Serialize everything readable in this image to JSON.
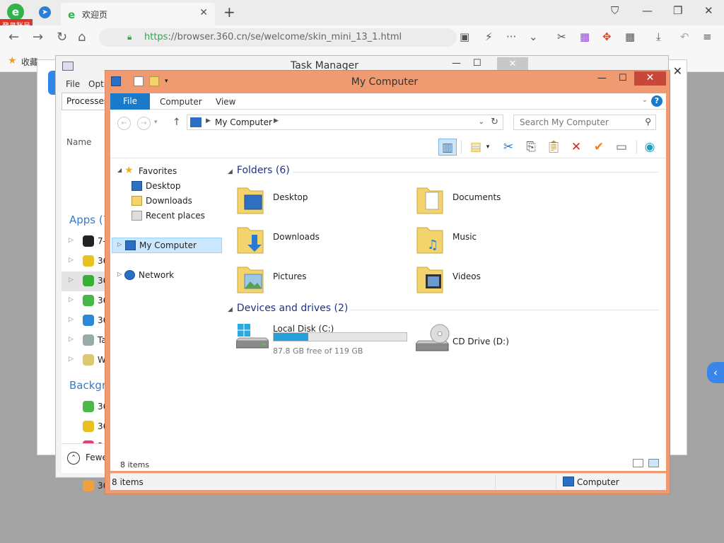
{
  "browser": {
    "logo_letter": "e",
    "login_badge": "登录账号",
    "tab_title": "欢迎页",
    "tab_favicon": "e",
    "url_proto": "https",
    "url_rest": "://browser.360.cn/se/welcome/skin_mini_13_1.html",
    "bookmark_label": "收藏"
  },
  "task_manager": {
    "title": "Task Manager",
    "menu": [
      "File",
      "Opti"
    ],
    "tab": "Processes",
    "col_name": "Name",
    "apps_group": "Apps (7",
    "background_group": "Backgro",
    "apps": [
      "7-",
      "36",
      "36",
      "36",
      "36",
      "Ta",
      "W"
    ],
    "background": [
      "36",
      "36",
      "36",
      "36",
      "36"
    ],
    "footer": "Fewe"
  },
  "my_computer": {
    "title": "My Computer",
    "ribbon": {
      "file": "File",
      "computer": "Computer",
      "view": "View",
      "help": "?"
    },
    "address": "My Computer",
    "search_placeholder": "Search My Computer",
    "nav": {
      "favorites": "Favorites",
      "desktop": "Desktop",
      "downloads": "Downloads",
      "recent": "Recent places",
      "my_computer": "My Computer",
      "network": "Network"
    },
    "folders_header": "Folders (6)",
    "folders": [
      "Desktop",
      "Documents",
      "Downloads",
      "Music",
      "Pictures",
      "Videos"
    ],
    "devices_header": "Devices and drives (2)",
    "drive_c": {
      "name": "Local Disk (C:)",
      "free": "87.8 GB free of 119 GB",
      "used_fraction": 0.26
    },
    "drive_d": {
      "name": "CD Drive (D:)"
    },
    "inner_status": "8 items",
    "status_count": "8 items",
    "status_location": "Computer"
  },
  "colors": {
    "window_frame": "#f09a72",
    "accent_blue": "#1979ca",
    "close_red": "#c9463b",
    "folder_yellow": "#f3d36b"
  }
}
